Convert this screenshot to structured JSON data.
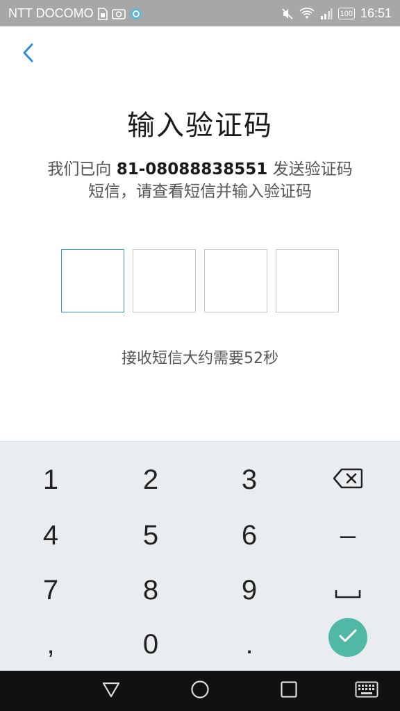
{
  "status_bar": {
    "carrier": "NTT DOCOMO",
    "battery": "100",
    "time": "16:51",
    "icons": [
      "sim-card-icon",
      "camera-icon",
      "sync-icon",
      "mute-icon",
      "wifi-icon",
      "signal-icon",
      "battery-icon"
    ]
  },
  "header": {
    "back_icon": "chevron-left-icon",
    "title": "输入验证码"
  },
  "description": {
    "prefix": "我们已向 ",
    "phone": "81-08088838551",
    "suffix_line1": " 发送验证码",
    "line2": "短信，请查看短信并输入验证码"
  },
  "code_input": {
    "digits": [
      "",
      "",
      "",
      ""
    ],
    "active_index": 0
  },
  "timer_text": "接收短信大约需要52秒",
  "keyboard": {
    "keys": [
      [
        "1",
        "2",
        "3"
      ],
      [
        "4",
        "5",
        "6"
      ],
      [
        "7",
        "8",
        "9"
      ],
      [
        ",",
        "0",
        "."
      ]
    ],
    "dash": "–",
    "backspace_icon": "backspace-icon",
    "space_icon": "space-icon",
    "enter_icon": "checkmark-icon",
    "accent": "#51b8a6"
  },
  "nav_bar": {
    "icons": [
      "back-triangle-icon",
      "home-circle-icon",
      "recents-square-icon",
      "keyboard-icon"
    ]
  },
  "colors": {
    "accent_blue": "#2a90d8",
    "status_bar_bg": "#a7a7a7",
    "keyboard_bg": "#eaedf0"
  }
}
